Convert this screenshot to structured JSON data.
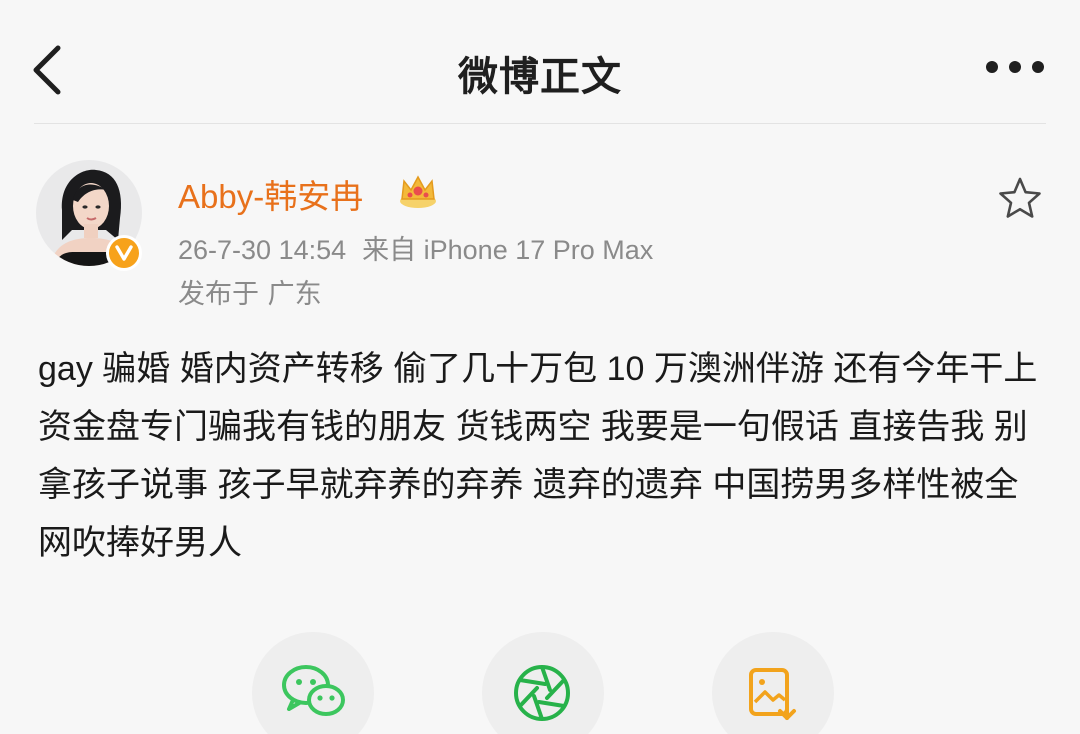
{
  "header": {
    "title": "微博正文"
  },
  "post": {
    "username": "Abby-韩安冉",
    "date": "26-7-30 14:54",
    "source": "来自 iPhone 17 Pro Max",
    "location": "发布于 广东",
    "text": "gay 骗婚 婚内资产转移 偷了几十万包 10 万澳洲伴游 还有今年干上资金盘专门骗我有钱的朋友 货钱两空 我要是一句假话 直接告我 别拿孩子说事 孩子早就弃养的弃养 遗弃的遗弃 中国捞男多样性被全网吹捧好男人"
  },
  "colors": {
    "username": "#e8711b",
    "verified": "#f7a21b",
    "wechat": "#3cc65e",
    "moments": "#27b24a",
    "save": "#f2a31c"
  },
  "icons": {
    "back": "chevron-left-icon",
    "more": "more-dots-icon",
    "favorite": "star-outline-icon",
    "member": "crown-icon",
    "verified": "verified-v-icon",
    "share_wechat": "wechat-icon",
    "share_moments": "moments-aperture-icon",
    "save_image": "image-download-icon"
  }
}
